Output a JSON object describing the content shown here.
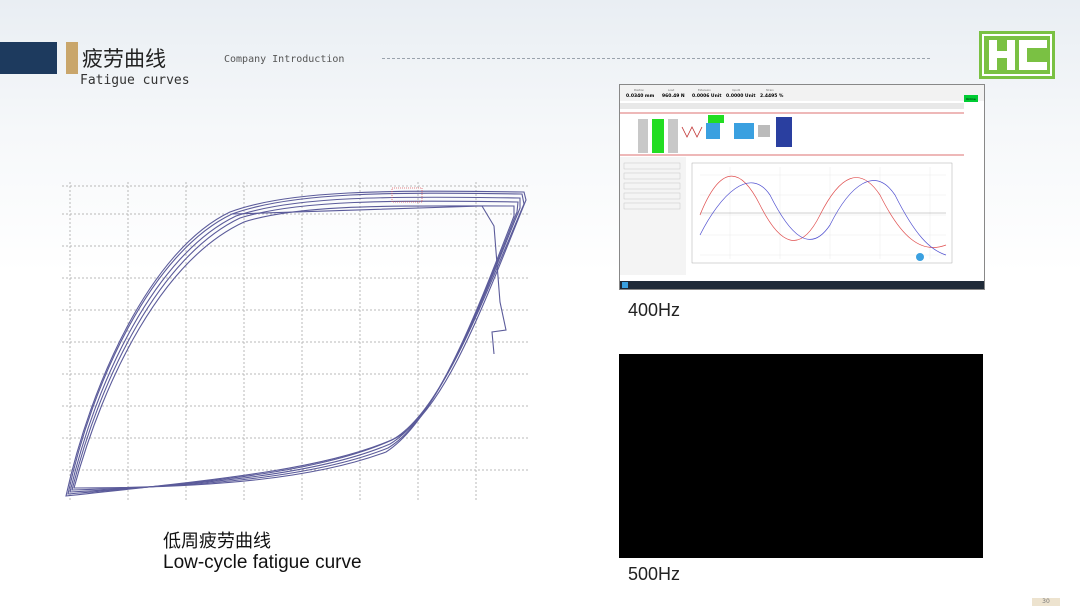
{
  "header": {
    "title_cn": "疲劳曲线",
    "title_en": "Fatigue curves",
    "company": "Company Introduction"
  },
  "logo": {
    "text": "HC",
    "color": "#7ac143"
  },
  "left_figure": {
    "caption_cn": "低周疲劳曲线",
    "caption_en": "Low-cycle fatigue curve",
    "line_color": "#5b5b9a"
  },
  "right_top": {
    "label": "400Hz",
    "readouts": [
      {
        "name": "Position",
        "value": "0.0340 mm"
      },
      {
        "name": "Load",
        "value": "960.49 N"
      },
      {
        "name": "Extension",
        "value": "0.0006 Unit"
      },
      {
        "name": "Input1",
        "value": "0.0000 Unit"
      },
      {
        "name": "Strain",
        "value": "2.4495 %"
      }
    ],
    "status_button": "Online",
    "accent": "#00cc33"
  },
  "right_bottom": {
    "label": "500Hz"
  },
  "page_number": "30"
}
